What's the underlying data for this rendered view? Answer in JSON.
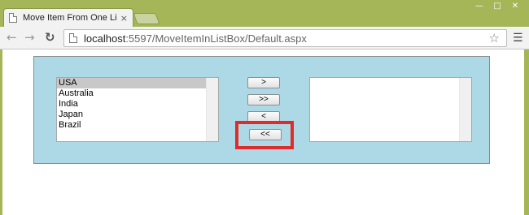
{
  "browser": {
    "tab_title": "Move Item From One List",
    "tab_close": "×",
    "url_host": "localhost",
    "url_rest": ":5597/MoveItemInListBox/Default.aspx",
    "icons": {
      "back": "back-arrow-icon",
      "forward": "forward-arrow-icon",
      "reload": "reload-icon",
      "bookmark": "star-icon",
      "menu": "hamburger-menu-icon",
      "minimize": "minimize-icon",
      "maximize": "maximize-icon",
      "close": "close-icon"
    }
  },
  "page": {
    "panel_color": "#add8e6",
    "highlight_color": "#e02b2b",
    "left_list": {
      "items": [
        "USA",
        "Australia",
        "India",
        "Japan",
        "Brazil"
      ],
      "selected": "USA"
    },
    "right_list": {
      "items": []
    },
    "buttons": {
      "move_one_right": ">",
      "move_all_right": ">>",
      "move_one_left": "<",
      "move_all_left": "<<"
    }
  }
}
